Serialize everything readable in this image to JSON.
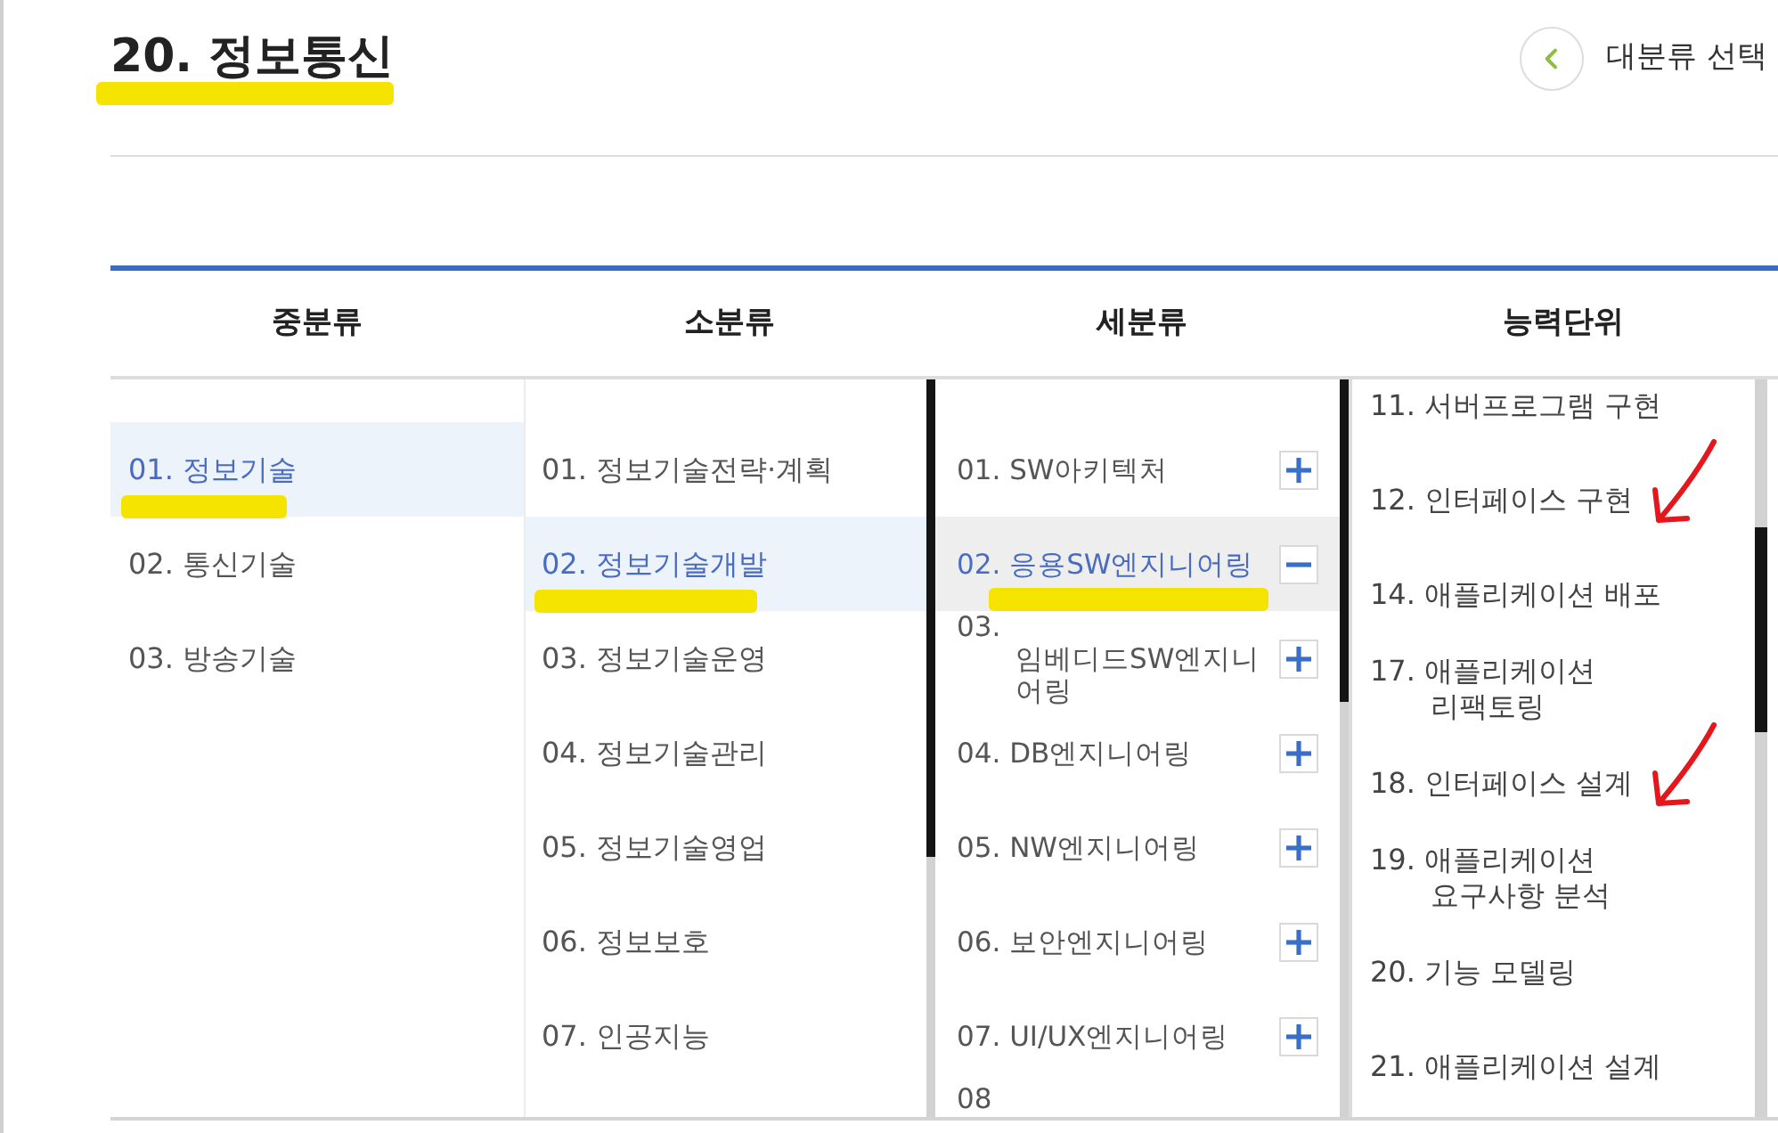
{
  "title": {
    "text": "20. 정보통신",
    "highlighted": true
  },
  "back_button": {
    "label": "대분류 선택"
  },
  "columns": [
    {
      "heading": "중분류",
      "kind": "list",
      "items": [
        {
          "label": "01. 정보기술",
          "selected": true,
          "highlighted": true
        },
        {
          "label": "02. 통신기술",
          "selected": false,
          "highlighted": false
        },
        {
          "label": "03. 방송기술",
          "selected": false,
          "highlighted": false
        }
      ]
    },
    {
      "heading": "소분류",
      "kind": "list",
      "items": [
        {
          "label": "01. 정보기술전략·계획",
          "selected": false,
          "highlighted": false
        },
        {
          "label": "02. 정보기술개발",
          "selected": true,
          "highlighted": true
        },
        {
          "label": "03. 정보기술운영",
          "selected": false,
          "highlighted": false
        },
        {
          "label": "04. 정보기술관리",
          "selected": false,
          "highlighted": false
        },
        {
          "label": "05. 정보기술영업",
          "selected": false,
          "highlighted": false
        },
        {
          "label": "06. 정보보호",
          "selected": false,
          "highlighted": false
        },
        {
          "label": "07. 인공지능",
          "selected": false,
          "highlighted": false
        }
      ]
    },
    {
      "heading": "세분류",
      "kind": "expandable",
      "items": [
        {
          "label": "01. SW아키텍처",
          "selected": false,
          "expanded": false,
          "highlighted": false
        },
        {
          "label": "02. 응용SW엔지니어링",
          "selected": true,
          "expanded": true,
          "highlighted": true
        },
        {
          "label": "03. 임베디드SW엔지니어링",
          "selected": false,
          "expanded": false,
          "highlighted": false
        },
        {
          "label": "04. DB엔지니어링",
          "selected": false,
          "expanded": false,
          "highlighted": false
        },
        {
          "label": "05. NW엔지니어링",
          "selected": false,
          "expanded": false,
          "highlighted": false
        },
        {
          "label": "06. 보안엔지니어링",
          "selected": false,
          "expanded": false,
          "highlighted": false
        },
        {
          "label": "07. UI/UX엔지니어링",
          "selected": false,
          "expanded": false,
          "highlighted": false
        },
        {
          "label": "08",
          "selected": false,
          "highlighted": false
        }
      ]
    },
    {
      "heading": "능력단위",
      "kind": "units",
      "items": [
        {
          "label": "11. 서버프로그램 구현",
          "selected": false,
          "arrow": false
        },
        {
          "label": "12. 인터페이스 구현",
          "selected": false,
          "arrow": true
        },
        {
          "label": "14. 애플리케이션 배포",
          "selected": false,
          "arrow": false
        },
        {
          "label": "17. 애플리케이션 리팩토링",
          "selected": false,
          "arrow": false
        },
        {
          "label": "18. 인터페이스 설계",
          "selected": false,
          "arrow": true
        },
        {
          "label": "19. 애플리케이션 요구사항 분석",
          "selected": false,
          "arrow": false
        },
        {
          "label": "20. 기능 모델링",
          "selected": false,
          "arrow": false
        },
        {
          "label": "21. 애플리케이션 설계",
          "selected": false,
          "arrow": false
        }
      ]
    }
  ]
}
